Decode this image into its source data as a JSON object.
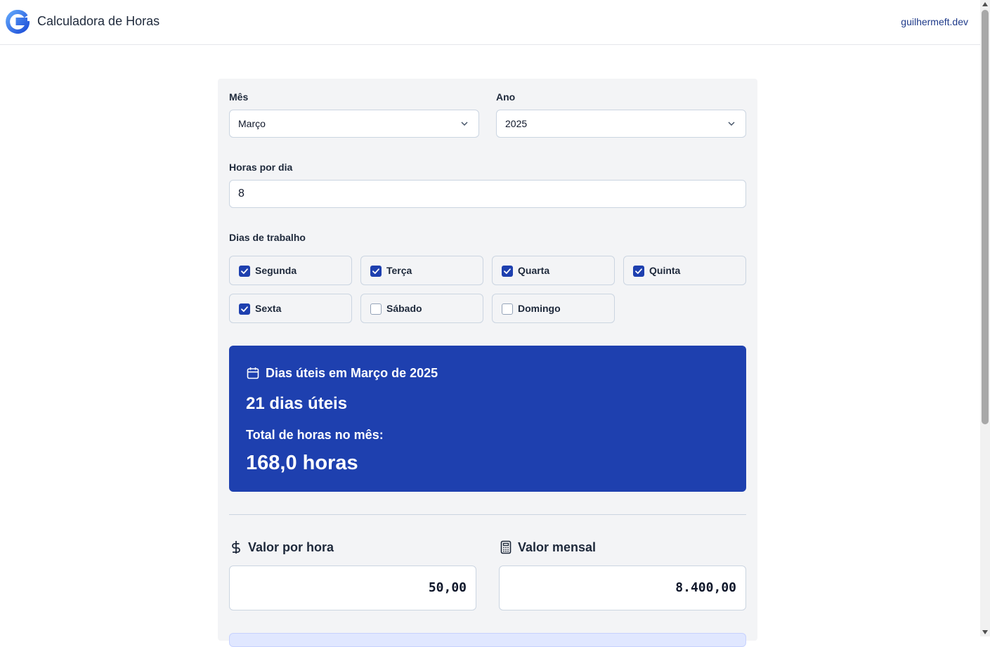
{
  "header": {
    "title": "Calculadora de Horas",
    "site_link": "guilhermeft.dev",
    "brand_color": "#1e40af"
  },
  "form": {
    "month_label": "Mês",
    "month_value": "Março",
    "year_label": "Ano",
    "year_value": "2025",
    "hours_label": "Horas por dia",
    "hours_value": "8",
    "days_label": "Dias de trabalho",
    "days": [
      {
        "label": "Segunda",
        "checked": true
      },
      {
        "label": "Terça",
        "checked": true
      },
      {
        "label": "Quarta",
        "checked": true
      },
      {
        "label": "Quinta",
        "checked": true
      },
      {
        "label": "Sexta",
        "checked": true
      },
      {
        "label": "Sábado",
        "checked": false
      },
      {
        "label": "Domingo",
        "checked": false
      }
    ]
  },
  "summary": {
    "title": "Dias úteis em Março de 2025",
    "business_days": "21 dias úteis",
    "total_label": "Total de horas no mês:",
    "total_hours": "168,0 horas",
    "background_color": "#1e40af"
  },
  "values": {
    "hourly_label": "Valor por hora",
    "hourly_value": "50,00",
    "monthly_label": "Valor mensal",
    "monthly_value": "8.400,00"
  }
}
